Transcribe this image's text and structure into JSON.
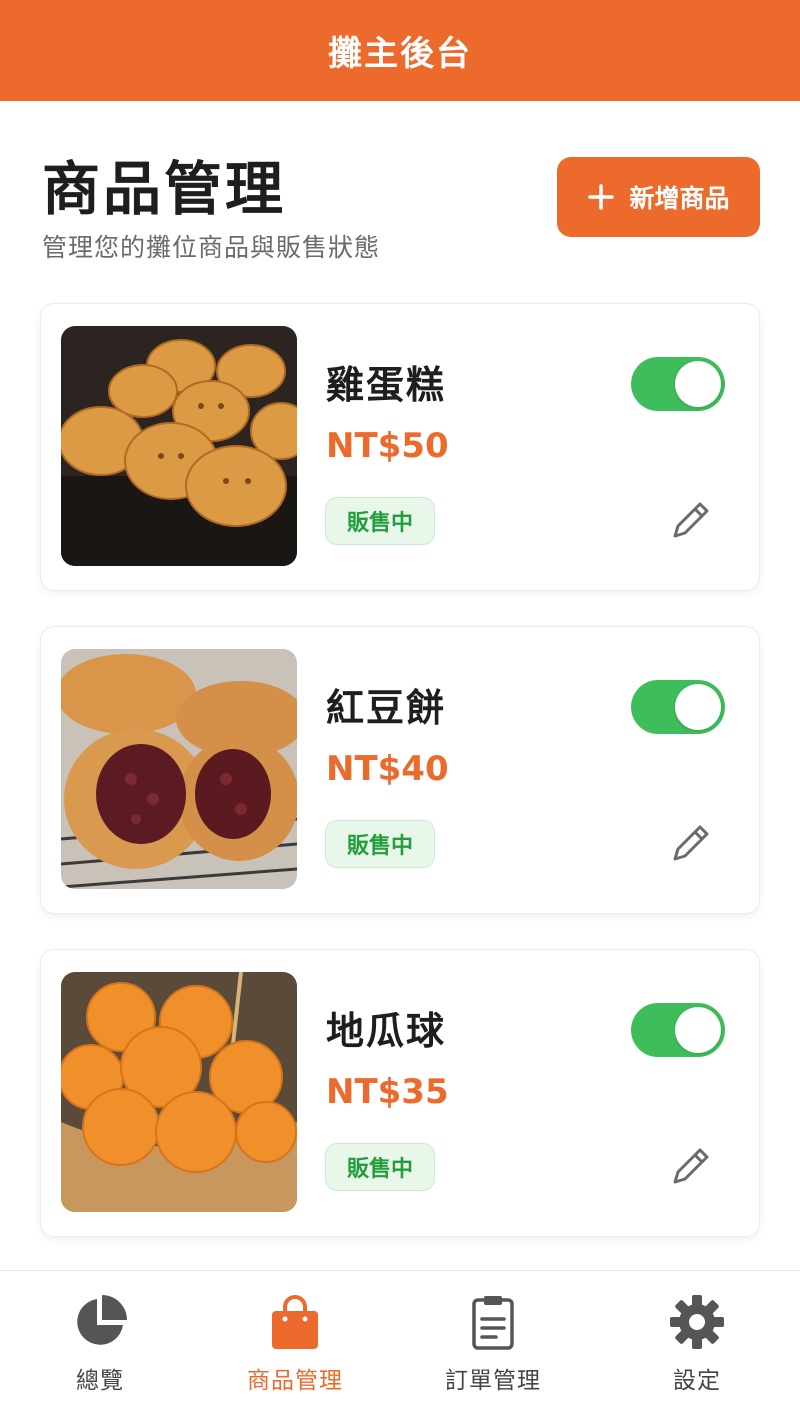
{
  "header": {
    "title": "攤主後台"
  },
  "page": {
    "title": "商品管理",
    "subtitle": "管理您的攤位商品與販售狀態",
    "add_button_label": "新增商品"
  },
  "products": [
    {
      "name": "雞蛋糕",
      "price": "NT$50",
      "status": "販售中",
      "on_sale": true,
      "image": "egg-cake-photo"
    },
    {
      "name": "紅豆餅",
      "price": "NT$40",
      "status": "販售中",
      "on_sale": true,
      "image": "red-bean-cake-photo"
    },
    {
      "name": "地瓜球",
      "price": "NT$35",
      "status": "販售中",
      "on_sale": true,
      "image": "sweet-potato-ball-photo"
    }
  ],
  "nav": {
    "items": [
      {
        "label": "總覽",
        "icon": "pie-chart-icon",
        "active": false
      },
      {
        "label": "商品管理",
        "icon": "shopping-bag-icon",
        "active": true
      },
      {
        "label": "訂單管理",
        "icon": "clipboard-icon",
        "active": false
      },
      {
        "label": "設定",
        "icon": "gear-icon",
        "active": false
      }
    ]
  },
  "colors": {
    "accent": "#ec6a2c",
    "toggle_on": "#3ebd5a",
    "badge_text": "#229e3d",
    "badge_bg": "#e8f7ea"
  }
}
